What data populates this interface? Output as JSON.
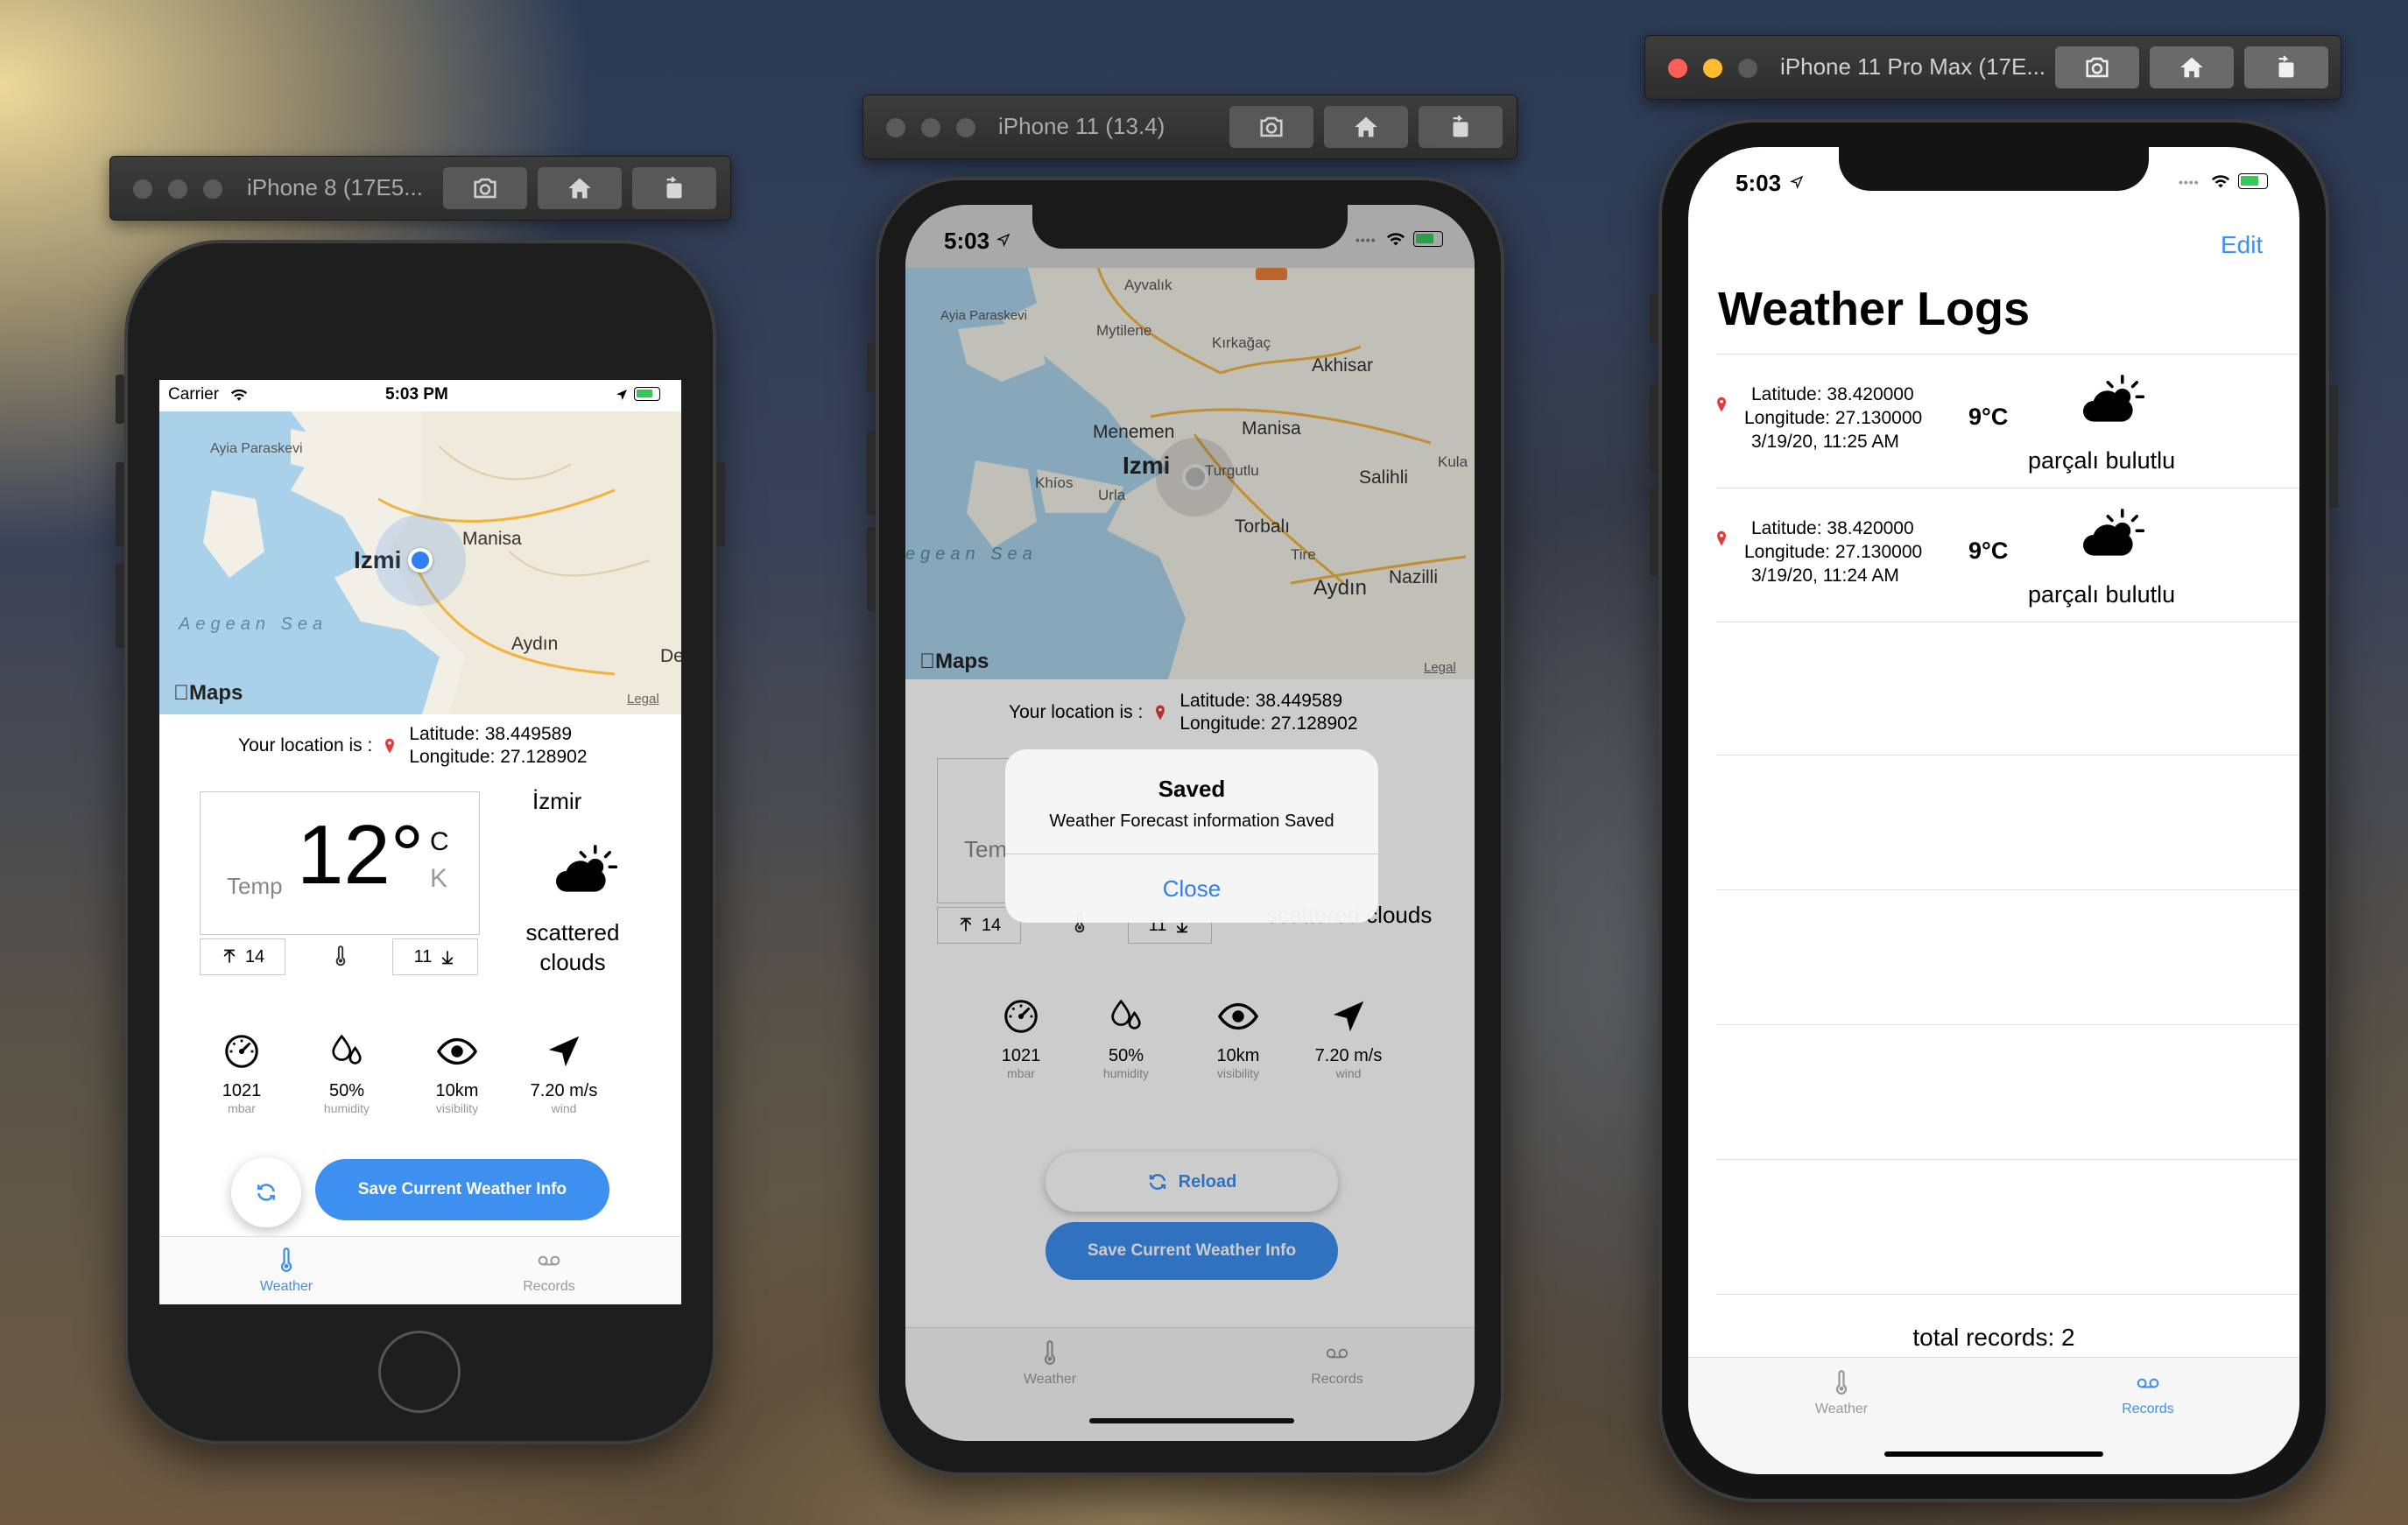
{
  "simulators": [
    {
      "title": "iPhone 8 (17E5...",
      "buttons": [
        "screenshot",
        "home",
        "rotate"
      ]
    },
    {
      "title": "iPhone 11 (13.4)",
      "buttons": [
        "screenshot",
        "home",
        "rotate"
      ]
    },
    {
      "title": "iPhone 11 Pro Max (17E...",
      "buttons": [
        "screenshot",
        "home",
        "rotate"
      ]
    }
  ],
  "phone1": {
    "status": {
      "carrier": "Carrier",
      "time": "5:03 PM"
    },
    "map": {
      "labels": [
        "Ayia Paraskevi",
        "Izmi",
        "Manisa",
        "Aegean Sea",
        "Aydın",
        "De"
      ],
      "maps_logo": "Maps",
      "legal": "Legal"
    },
    "location_label": "Your location is :",
    "latitude": "Latitude: 38.449589",
    "longitude": "Longitude: 27.128902",
    "temp_label": "Temp",
    "temp_value": "12°",
    "unit_c": "C",
    "unit_k": "K",
    "max_temp": "14",
    "min_temp": "11",
    "city": "İzmir",
    "condition_line1": "scattered",
    "condition_line2": "clouds",
    "metrics": [
      {
        "value": "1021",
        "unit": "mbar",
        "icon": "pressure-gauge-icon"
      },
      {
        "value": "50%",
        "unit": "humidity",
        "icon": "humidity-drops-icon"
      },
      {
        "value": "10km",
        "unit": "visibility",
        "icon": "eye-icon"
      },
      {
        "value": "7.20 m/s",
        "unit": "wind",
        "icon": "wind-arrow-icon"
      }
    ],
    "save_button": "Save Current Weather Info",
    "tabs": [
      {
        "label": "Weather",
        "active": true
      },
      {
        "label": "Records",
        "active": false
      }
    ]
  },
  "phone2": {
    "status": {
      "time": "5:03"
    },
    "map": {
      "labels": [
        "Ayvalık",
        "Ayia Paraskevi",
        "Mytilene",
        "Kırkağaç",
        "Akhisar",
        "Menemen",
        "Manisa",
        "Izmi",
        "Turgutlu",
        "Salihli",
        "Kula",
        "Khíos",
        "Urla",
        "egean Sea",
        "Torbalı",
        "Tire",
        "Aydın",
        "Nazilli"
      ],
      "maps_logo": "Maps",
      "legal": "Legal"
    },
    "location_label": "Your location is :",
    "latitude": "Latitude: 38.449589",
    "longitude": "Longitude: 27.128902",
    "partial_temp_label": "Tem",
    "max_temp": "14",
    "min_temp": "11",
    "partial_condition": "scattered clouds",
    "metrics": [
      {
        "value": "1021",
        "unit": "mbar",
        "icon": "pressure-gauge-icon"
      },
      {
        "value": "50%",
        "unit": "humidity",
        "icon": "humidity-drops-icon"
      },
      {
        "value": "10km",
        "unit": "visibility",
        "icon": "eye-icon"
      },
      {
        "value": "7.20 m/s",
        "unit": "wind",
        "icon": "wind-arrow-icon"
      }
    ],
    "reload_button": "Reload",
    "save_button": "Save Current Weather Info",
    "alert": {
      "title": "Saved",
      "message": "Weather Forecast information Saved",
      "button": "Close"
    },
    "tabs": [
      {
        "label": "Weather",
        "active": false
      },
      {
        "label": "Records",
        "active": false
      }
    ]
  },
  "phone3": {
    "status": {
      "time": "5:03"
    },
    "edit_button": "Edit",
    "title": "Weather Logs",
    "records": [
      {
        "latitude": "Latitude: 38.420000",
        "longitude": "Longitude: 27.130000",
        "date": "3/19/20, 11:25 AM",
        "temp": "9°C",
        "description": "parçalı bulutlu"
      },
      {
        "latitude": "Latitude: 38.420000",
        "longitude": "Longitude: 27.130000",
        "date": "3/19/20, 11:24 AM",
        "temp": "9°C",
        "description": "parçalı bulutlu"
      }
    ],
    "total_records": "total records: 2",
    "tabs": [
      {
        "label": "Weather",
        "active": false
      },
      {
        "label": "Records",
        "active": true
      }
    ]
  },
  "colors": {
    "accent": "#3d8ff0",
    "alert_button": "#2f7ff2",
    "location_dot": "#2f7ff2"
  }
}
